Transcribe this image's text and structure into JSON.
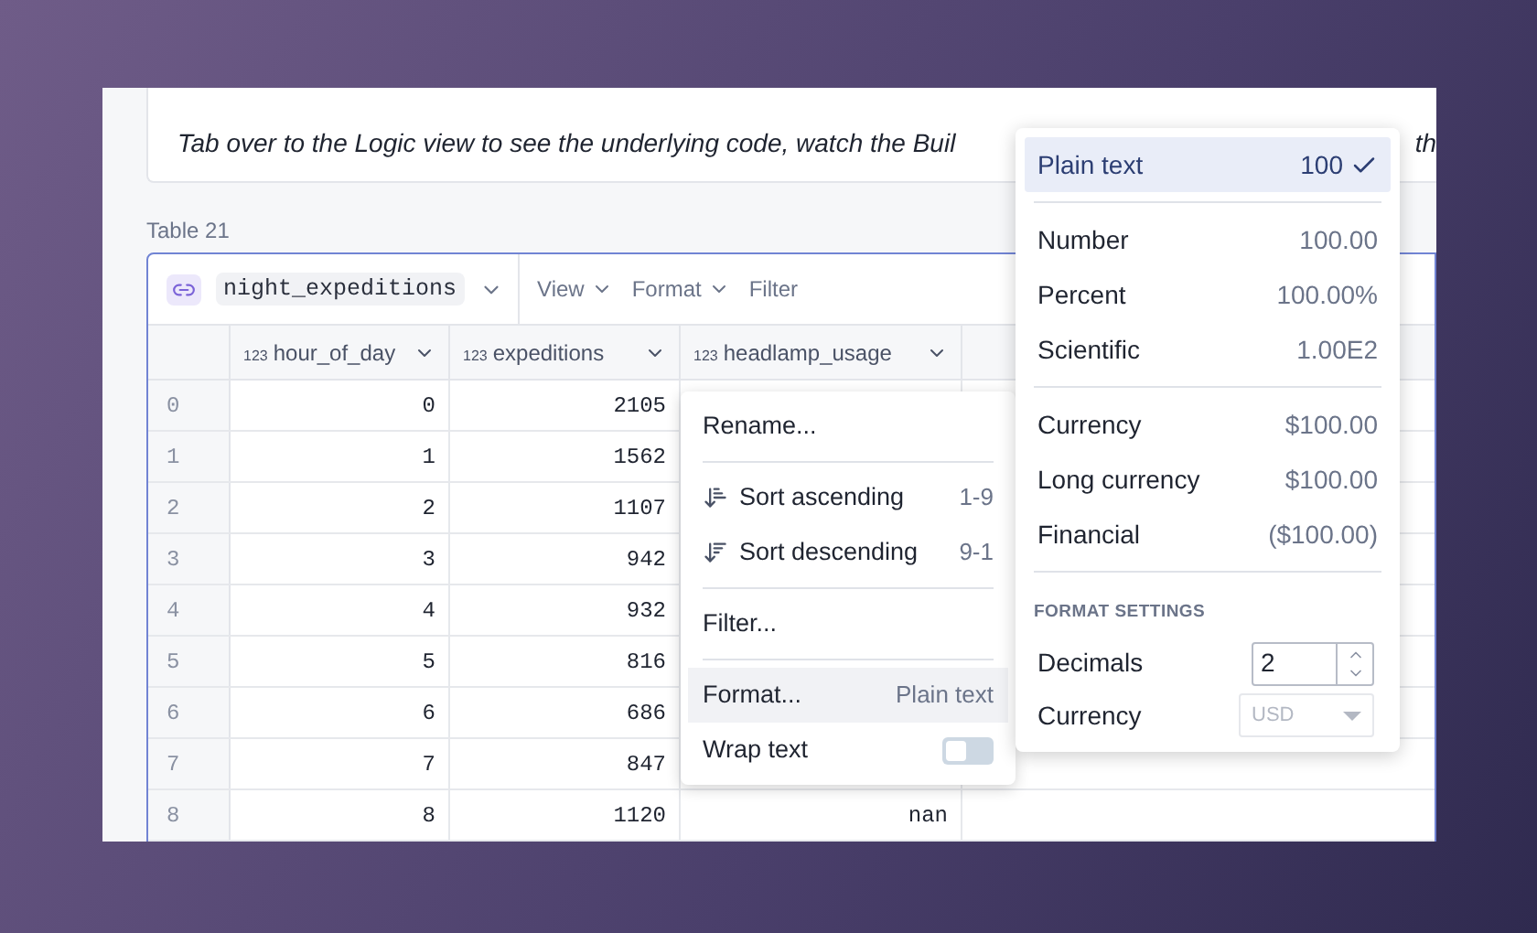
{
  "intro": {
    "text": "Tab over to the Logic view to see the underlying code, watch the Buil",
    "tail": "th"
  },
  "table": {
    "title": "Table 21",
    "source": "night_expeditions",
    "toolbar": [
      "View",
      "Format",
      "Filter"
    ],
    "columns": [
      {
        "type": "123",
        "name": "hour_of_day"
      },
      {
        "type": "123",
        "name": "expeditions"
      },
      {
        "type": "123",
        "name": "headlamp_usage"
      }
    ],
    "rows": [
      {
        "index": "0",
        "cells": [
          "0",
          "2105"
        ]
      },
      {
        "index": "1",
        "cells": [
          "1",
          "1562"
        ]
      },
      {
        "index": "2",
        "cells": [
          "2",
          "1107"
        ]
      },
      {
        "index": "3",
        "cells": [
          "3",
          "942"
        ]
      },
      {
        "index": "4",
        "cells": [
          "4",
          "932"
        ]
      },
      {
        "index": "5",
        "cells": [
          "5",
          "816"
        ]
      },
      {
        "index": "6",
        "cells": [
          "6",
          "686"
        ]
      },
      {
        "index": "7",
        "cells": [
          "7",
          "847"
        ]
      },
      {
        "index": "8",
        "cells": [
          "8",
          "1120",
          "nan"
        ]
      }
    ]
  },
  "column_menu": {
    "groups": [
      [
        {
          "kind": "item",
          "label": "Rename..."
        }
      ],
      [
        {
          "kind": "sort_asc",
          "label": "Sort ascending",
          "hint": "1-9"
        },
        {
          "kind": "sort_desc",
          "label": "Sort descending",
          "hint": "9-1"
        }
      ],
      [
        {
          "kind": "item",
          "label": "Filter..."
        }
      ],
      [
        {
          "kind": "item",
          "label": "Format...",
          "hint": "Plain text",
          "highlighted": true
        },
        {
          "kind": "toggle",
          "label": "Wrap text",
          "on": false
        }
      ]
    ]
  },
  "format_menu": {
    "groups": [
      [
        {
          "label": "Plain text",
          "example": "100",
          "selected": true
        }
      ],
      [
        {
          "label": "Number",
          "example": "100.00",
          "selected": false
        },
        {
          "label": "Percent",
          "example": "100.00%",
          "selected": false
        },
        {
          "label": "Scientific",
          "example": "1.00E2",
          "selected": false
        }
      ],
      [
        {
          "label": "Currency",
          "example": "$100.00",
          "selected": false
        },
        {
          "label": "Long currency",
          "example": "$100.00",
          "selected": false
        },
        {
          "label": "Financial",
          "example": "($100.00)",
          "selected": false
        }
      ]
    ],
    "settings_title": "FORMAT SETTINGS",
    "decimals": {
      "label": "Decimals",
      "value": "2"
    },
    "currency": {
      "label": "Currency",
      "value": "USD",
      "disabled": true
    }
  }
}
